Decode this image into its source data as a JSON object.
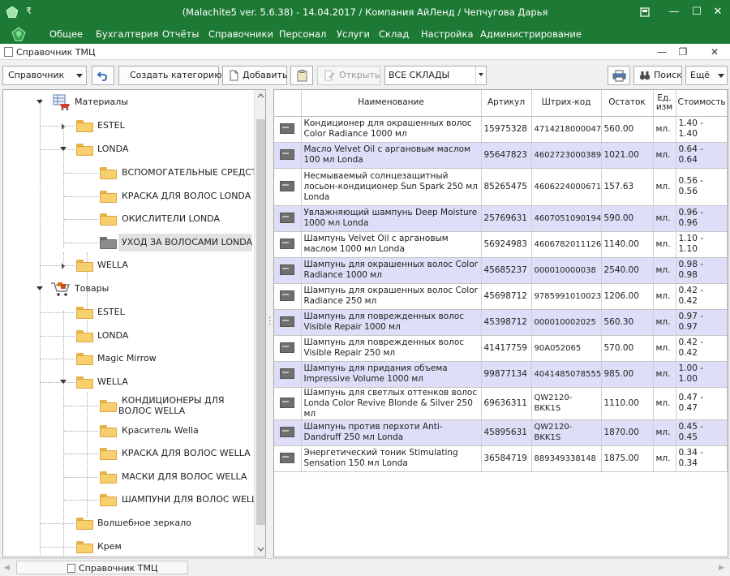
{
  "window": {
    "title": "(Malachite5 ver. 5.6.38) - 14.04.2017 / Компания АйЛенд / Чепчугова Дарья",
    "pin_glyph": "₹"
  },
  "menu": [
    "Общее",
    "Бухгалтерия",
    "Отчёты",
    "Справочники",
    "Персонал",
    "Услуги",
    "Склад",
    "Настройка",
    "Администрирование"
  ],
  "document": {
    "title": "Справочник ТМЦ"
  },
  "toolbar": {
    "mode_select": "Справочник",
    "create_category": "Создать категорию",
    "add": "Добавить",
    "open": "Открыть",
    "warehouse_select": "ВСЕ СКЛАДЫ",
    "search": "Поиск",
    "more": "Ещё"
  },
  "tree": [
    {
      "label": "Материалы",
      "level": 0,
      "type": "root-materials",
      "expanded": true
    },
    {
      "label": "ESTEL",
      "level": 1,
      "type": "folder",
      "expander": "collapsed"
    },
    {
      "label": "LONDA",
      "level": 1,
      "type": "folder",
      "expander": "expanded"
    },
    {
      "label": "ВСПОМОГАТЕЛЬНЫЕ СРЕДСТВА",
      "level": 2,
      "type": "folder"
    },
    {
      "label": "КРАСКА ДЛЯ ВОЛОС LONDA",
      "level": 2,
      "type": "folder"
    },
    {
      "label": "ОКИСЛИТЕЛИ LONDA",
      "level": 2,
      "type": "folder"
    },
    {
      "label": "УХОД ЗА ВОЛОСАМИ LONDA",
      "level": 2,
      "type": "folder-open",
      "selected": true
    },
    {
      "label": "WELLA",
      "level": 1,
      "type": "folder",
      "expander": "collapsed"
    },
    {
      "label": "Товары",
      "level": 0,
      "type": "root-goods",
      "expanded": true
    },
    {
      "label": "ESTEL",
      "level": 1,
      "type": "folder"
    },
    {
      "label": "LONDA",
      "level": 1,
      "type": "folder"
    },
    {
      "label": "Magic Mirrow",
      "level": 1,
      "type": "folder"
    },
    {
      "label": "WELLA",
      "level": 1,
      "type": "folder",
      "expander": "expanded"
    },
    {
      "label": "КОНДИЦИОНЕРЫ ДЛЯ ВОЛОС WELLA",
      "level": 2,
      "type": "folder",
      "wrap": true
    },
    {
      "label": "Краситель Wella",
      "level": 2,
      "type": "folder"
    },
    {
      "label": "КРАСКА ДЛЯ ВОЛОС WELLA",
      "level": 2,
      "type": "folder"
    },
    {
      "label": "МАСКИ ДЛЯ ВОЛОС WELLA",
      "level": 2,
      "type": "folder"
    },
    {
      "label": "ШАМПУНИ ДЛЯ ВОЛОС WELLA",
      "level": 2,
      "type": "folder"
    },
    {
      "label": "Волшебное зеркало",
      "level": 1,
      "type": "folder"
    },
    {
      "label": "Крем",
      "level": 1,
      "type": "folder"
    }
  ],
  "grid": {
    "headers": [
      "",
      "Наименование",
      "Артикул",
      "Штрих-код",
      "Остаток",
      "Ед. изм",
      "Стоимость"
    ],
    "rows": [
      {
        "name": "Кондиционер для окрашенных волос Color Radiance 1000 мл",
        "article": "15975328",
        "barcode": "4714218000047",
        "stock": "560.00",
        "unit": "мл.",
        "cost": "1.40 - 1.40"
      },
      {
        "name": "Масло Velvet Oil с аргановым маслом 100 мл Londa",
        "article": "95647823",
        "barcode": "4602723000389",
        "stock": "1021.00",
        "unit": "мл.",
        "cost": "0.64 - 0.64"
      },
      {
        "name": "Несмываемый солнцезащитный лосьон-кондиционер Sun Spark 250 мл Londa",
        "article": "85265475",
        "barcode": "4606224000671",
        "stock": "157.63",
        "unit": "мл.",
        "cost": "0.56 - 0.56"
      },
      {
        "name": "Увлажняющий шампунь Deep Moisture 1000 мл Londa",
        "article": "25769631",
        "barcode": "4607051090194",
        "stock": "590.00",
        "unit": "мл.",
        "cost": "0.96 - 0.96"
      },
      {
        "name": "Шампунь Velvet Oil с аргановым маслом 1000 мл Londa",
        "article": "56924983",
        "barcode": "4606782011126",
        "stock": "1140.00",
        "unit": "мл.",
        "cost": "1.10 - 1.10"
      },
      {
        "name": "Шампунь для окрашенных волос Color Radiance 1000 мл",
        "article": "45685237",
        "barcode": "000010000038",
        "stock": "2540.00",
        "unit": "мл.",
        "cost": "0.98 - 0.98"
      },
      {
        "name": "Шампунь для окрашенных волос Color Radiance 250 мл",
        "article": "45698712",
        "barcode": "9785991010023",
        "stock": "1206.00",
        "unit": "мл.",
        "cost": "0.42 - 0.42"
      },
      {
        "name": "Шампунь для поврежденных волос Visible Repair 1000 мл",
        "article": "45398712",
        "barcode": "000010002025",
        "stock": "560.30",
        "unit": "мл.",
        "cost": "0.97 - 0.97"
      },
      {
        "name": "Шампунь для поврежденных волос Visible Repair 250 мл",
        "article": "41417759",
        "barcode": "90A052065",
        "stock": "570.00",
        "unit": "мл.",
        "cost": "0.42 - 0.42"
      },
      {
        "name": "Шампунь для придания объема Impressive Volume 1000 мл",
        "article": "99877134",
        "barcode": "4041485078555",
        "stock": "985.00",
        "unit": "мл.",
        "cost": "1.00 - 1.00"
      },
      {
        "name": "Шампунь для светлых оттенков волос Londa Color Revive Blonde & Silver 250 мл",
        "article": "69636311",
        "barcode": "QW2120-BKK1S",
        "stock": "1110.00",
        "unit": "мл.",
        "cost": "0.47 - 0.47"
      },
      {
        "name": "Шампунь против перхоти Anti-Dandruff 250 мл Londa",
        "article": "45895631",
        "barcode": "QW2120-BKK1S",
        "stock": "1870.00",
        "unit": "мл.",
        "cost": "0.45 - 0.45"
      },
      {
        "name": "Энергетический тоник Stimulating Sensation 150 мл Londa",
        "article": "36584719",
        "barcode": "889349338148",
        "stock": "1875.00",
        "unit": "мл.",
        "cost": "0.34 - 0.34"
      }
    ]
  },
  "statusbar": {
    "task_label": "Справочник ТМЦ"
  },
  "colors": {
    "accent_green": "#1d7a35",
    "row_alt": "#dedef8",
    "folder": "#f7cf6c"
  }
}
